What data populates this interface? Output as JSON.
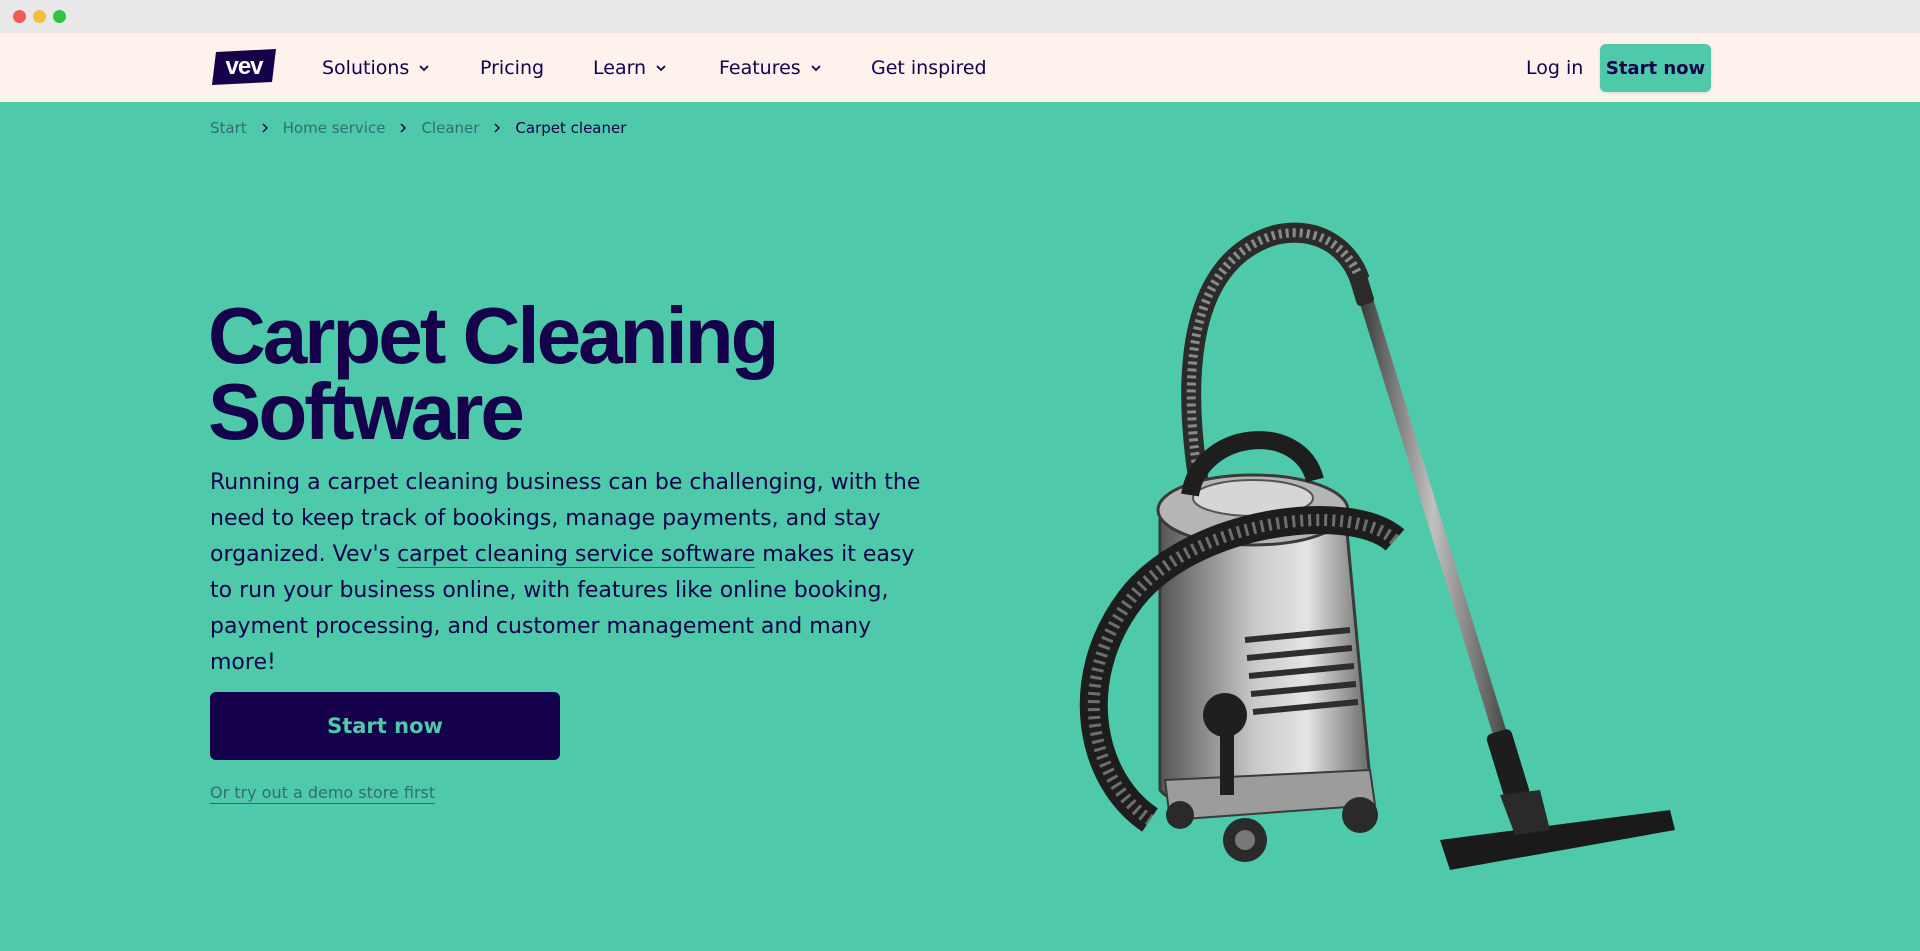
{
  "window": {
    "controls": [
      "close",
      "minimize",
      "maximize"
    ]
  },
  "nav": {
    "logo_text": "vev",
    "items": [
      {
        "label": "Solutions",
        "has_dropdown": true
      },
      {
        "label": "Pricing",
        "has_dropdown": false
      },
      {
        "label": "Learn",
        "has_dropdown": true
      },
      {
        "label": "Features",
        "has_dropdown": true
      },
      {
        "label": "Get inspired",
        "has_dropdown": false
      }
    ],
    "login_label": "Log in",
    "cta_label": "Start now"
  },
  "breadcrumb": [
    "Start",
    "Home service",
    "Cleaner",
    "Carpet cleaner"
  ],
  "hero": {
    "title_line1": "Carpet Cleaning",
    "title_line2": "Software",
    "text_before_link": "Running a carpet cleaning business can be challenging, with the need to keep track of bookings, manage payments, and stay organized. Vev's ",
    "link_text": "carpet cleaning service software",
    "text_after_link": " makes it easy to run your business online, with features like online booking, payment processing, and customer management and many more!",
    "cta_label": "Start now",
    "demo_link": "Or try out a demo store first",
    "image": "vacuum-cleaner-image"
  },
  "colors": {
    "background": "#4ecaab",
    "nav_background": "#fdf2ec",
    "navy": "#14004b",
    "muted_teal": "#2f6f73"
  }
}
